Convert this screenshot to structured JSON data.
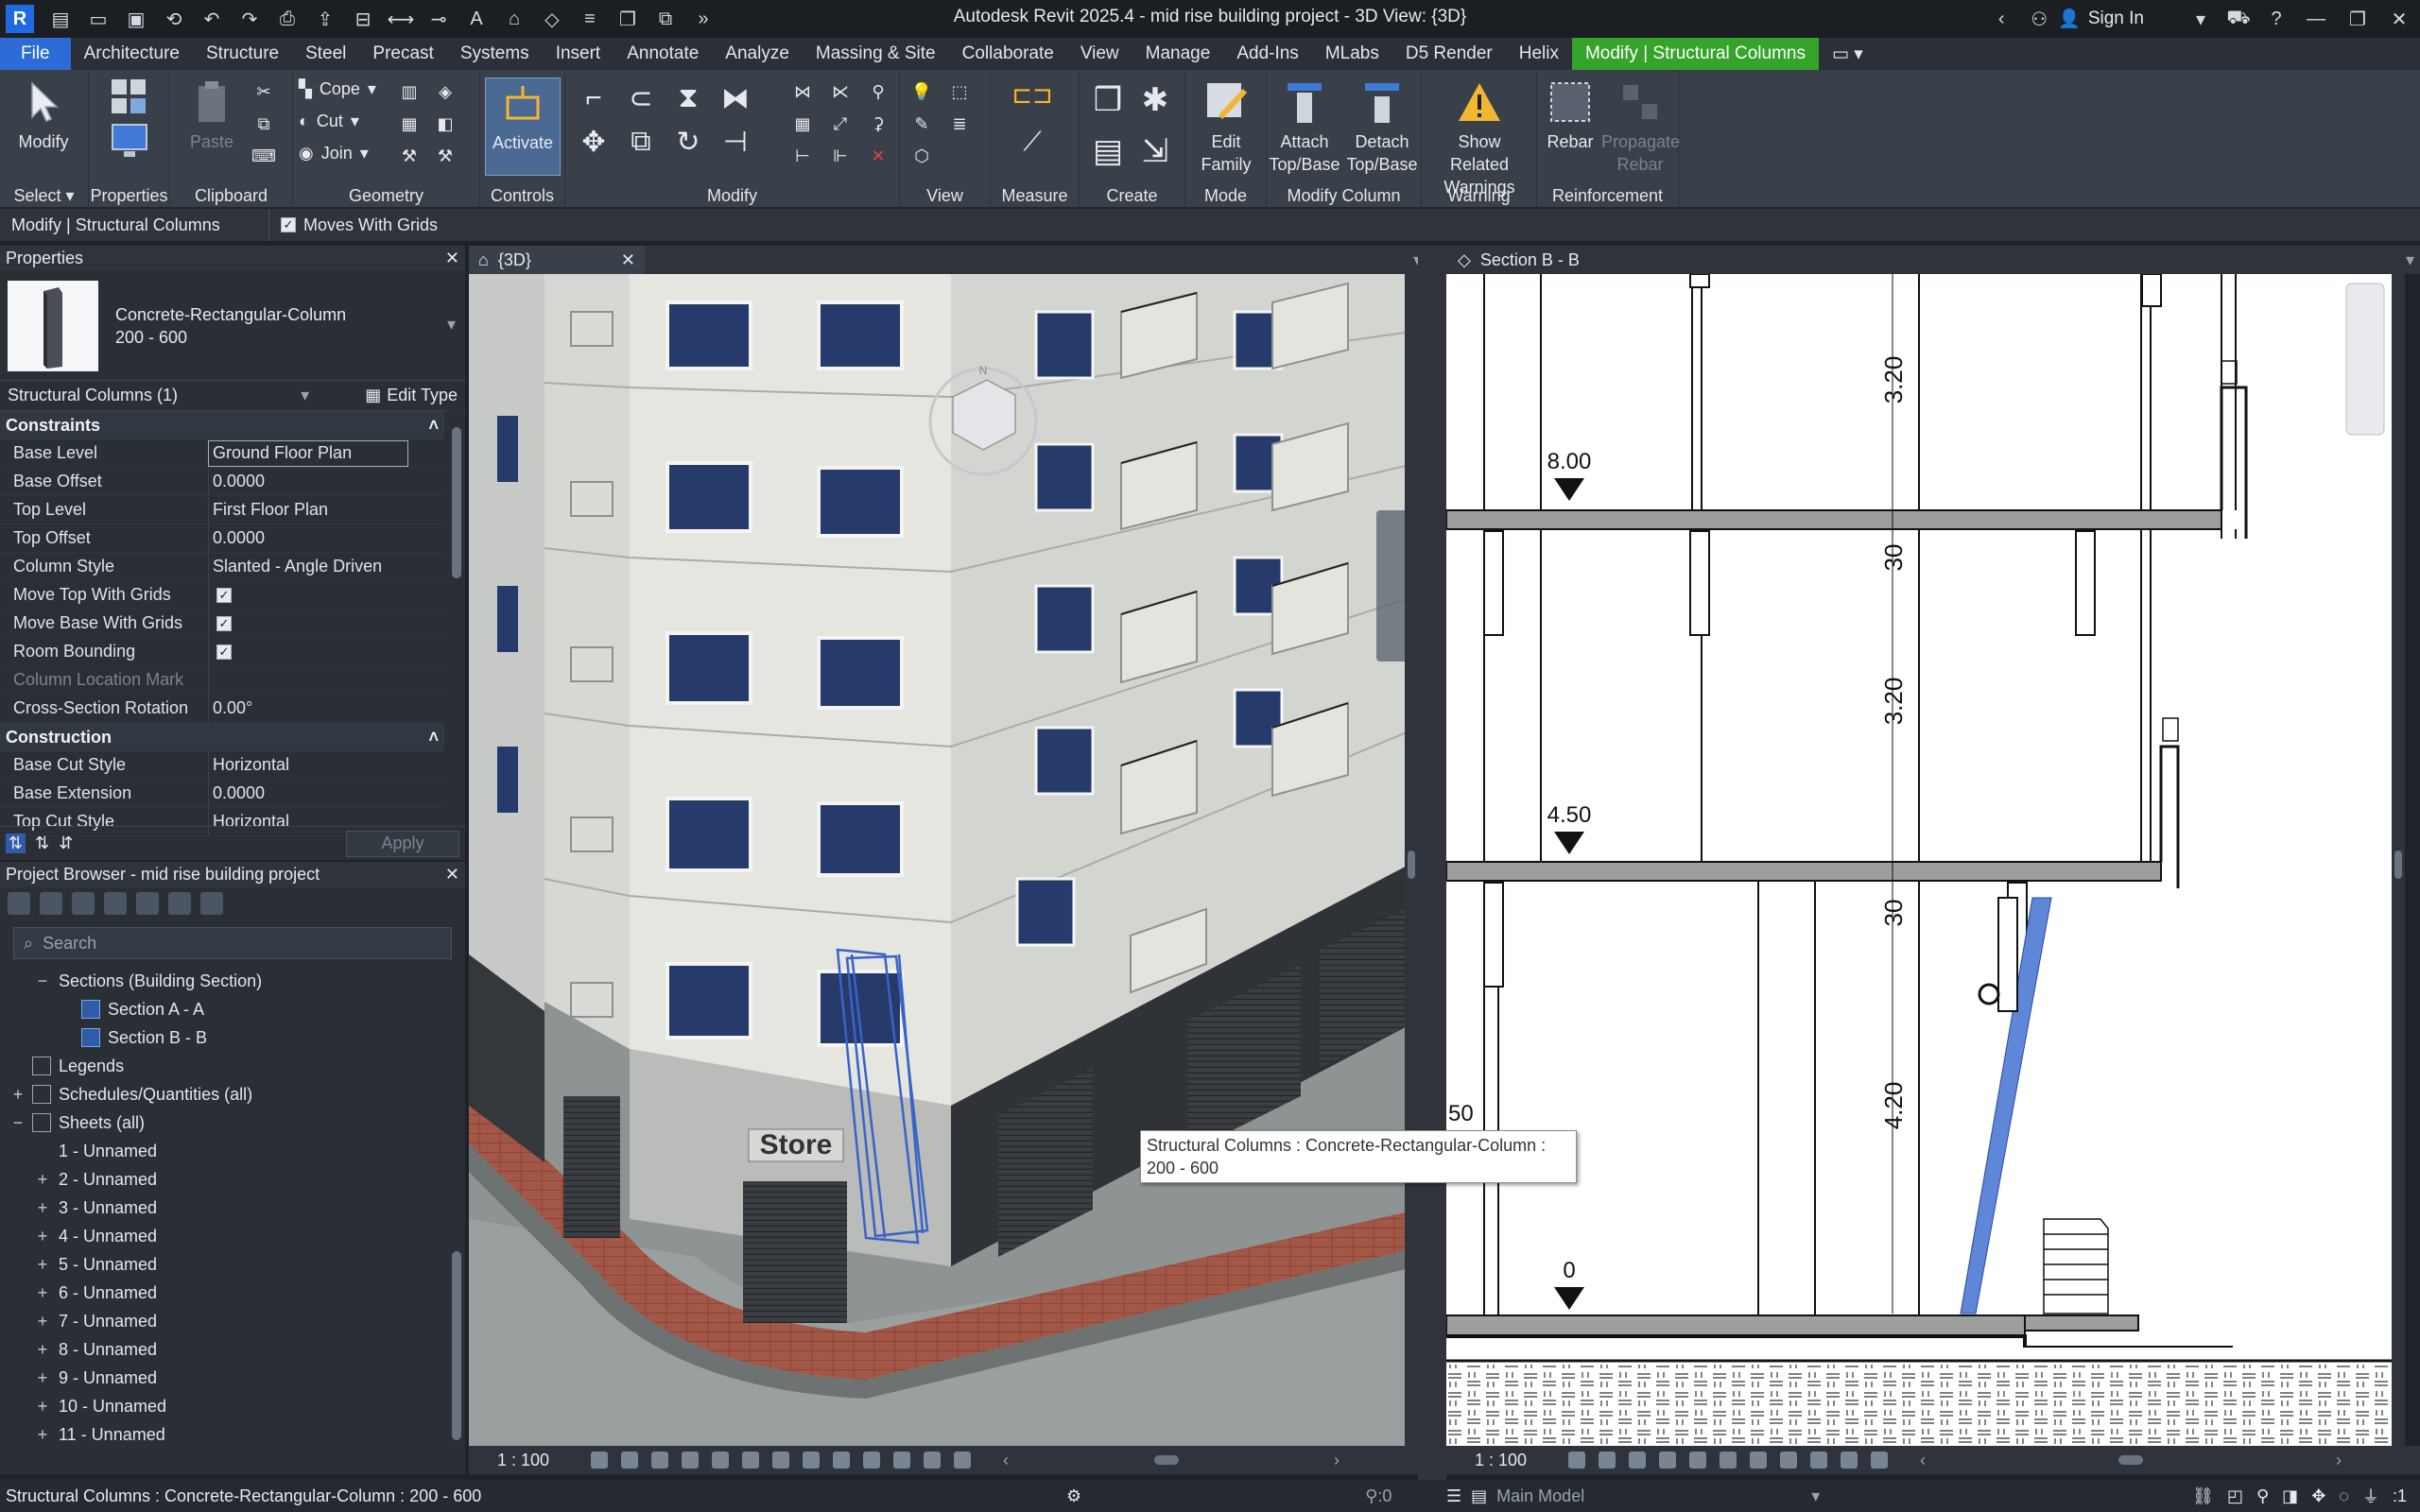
{
  "app": {
    "title": "Autodesk Revit 2025.4 - mid rise building project - 3D View: {3D}",
    "logo": "R",
    "sign_in": "Sign In"
  },
  "colors": {
    "file_tab": "#2d6bd6",
    "contextual_tab": "#35a42a",
    "accent_blue": "#2e5ca8",
    "warning": "#f2b632"
  },
  "ribbon_tabs": [
    "File",
    "Architecture",
    "Structure",
    "Steel",
    "Precast",
    "Systems",
    "Insert",
    "Annotate",
    "Analyze",
    "Massing & Site",
    "Collaborate",
    "View",
    "Manage",
    "Add-Ins",
    "MLabs",
    "D5 Render",
    "Helix",
    "Modify | Structural Columns"
  ],
  "ribbon": {
    "select": {
      "modify": "Modify",
      "label": "Select"
    },
    "properties": {
      "label": "Properties"
    },
    "clipboard": {
      "paste": "Paste",
      "label": "Clipboard"
    },
    "geometry": {
      "cope": "Cope",
      "cut": "Cut",
      "join": "Join",
      "label": "Geometry"
    },
    "controls": {
      "activate": "Activate",
      "label": "Controls"
    },
    "modify": {
      "label": "Modify"
    },
    "view": {
      "label": "View"
    },
    "measure": {
      "label": "Measure"
    },
    "create": {
      "label": "Create"
    },
    "mode": {
      "edit_family_1": "Edit",
      "edit_family_2": "Family",
      "label": "Mode"
    },
    "modify_column": {
      "attach_1": "Attach",
      "attach_2": "Top/Base",
      "detach_1": "Detach",
      "detach_2": "Top/Base",
      "label": "Modify Column"
    },
    "warning": {
      "show_1": "Show Related",
      "show_2": "Warnings",
      "label": "Warning"
    },
    "reinforcement": {
      "rebar": "Rebar",
      "propagate_1": "Propagate",
      "propagate_2": "Rebar",
      "label": "Reinforcement"
    }
  },
  "options_bar": {
    "context": "Modify | Structural Columns",
    "moves_with_grids": "Moves With Grids"
  },
  "properties": {
    "title": "Properties",
    "type_name": "Concrete-Rectangular-Column",
    "type_size": "200 - 600",
    "instance_filter": "Structural Columns (1)",
    "edit_type": "Edit Type",
    "apply": "Apply",
    "groups": [
      {
        "name": "Constraints",
        "rows": [
          {
            "k": "Base Level",
            "v": "Ground Floor Plan"
          },
          {
            "k": "Base Offset",
            "v": "0.0000"
          },
          {
            "k": "Top Level",
            "v": "First Floor Plan"
          },
          {
            "k": "Top Offset",
            "v": "0.0000"
          },
          {
            "k": "Column Style",
            "v": "Slanted - Angle Driven"
          },
          {
            "k": "Move Top With Grids",
            "v": ""
          },
          {
            "k": "Move Base With Grids",
            "v": ""
          },
          {
            "k": "Room Bounding",
            "v": ""
          },
          {
            "k": "Column Location Mark",
            "v": ""
          },
          {
            "k": "Cross-Section Rotation",
            "v": "0.00°"
          }
        ]
      },
      {
        "name": "Construction",
        "rows": [
          {
            "k": "Base Cut Style",
            "v": "Horizontal"
          },
          {
            "k": "Base Extension",
            "v": "0.0000"
          },
          {
            "k": "Top Cut Style",
            "v": "Horizontal"
          }
        ]
      }
    ]
  },
  "browser": {
    "title": "Project Browser - mid rise building project",
    "search_placeholder": "Search",
    "items": [
      {
        "label": "Sections (Building Section)",
        "exp": "−",
        "indent": 1,
        "icon": ""
      },
      {
        "label": "Section A - A",
        "exp": "",
        "indent": 2,
        "icon": "view"
      },
      {
        "label": "Section B - B",
        "exp": "",
        "indent": 2,
        "icon": "view"
      },
      {
        "label": "Legends",
        "exp": "",
        "indent": 0,
        "icon": "plain"
      },
      {
        "label": "Schedules/Quantities (all)",
        "exp": "+",
        "indent": 0,
        "icon": "plain"
      },
      {
        "label": "Sheets (all)",
        "exp": "−",
        "indent": 0,
        "icon": "plain"
      },
      {
        "label": "1 - Unnamed",
        "exp": "",
        "indent": 1,
        "icon": ""
      },
      {
        "label": "2 - Unnamed",
        "exp": "+",
        "indent": 1,
        "icon": ""
      },
      {
        "label": "3 - Unnamed",
        "exp": "+",
        "indent": 1,
        "icon": ""
      },
      {
        "label": "4 - Unnamed",
        "exp": "+",
        "indent": 1,
        "icon": ""
      },
      {
        "label": "5 - Unnamed",
        "exp": "+",
        "indent": 1,
        "icon": ""
      },
      {
        "label": "6 - Unnamed",
        "exp": "+",
        "indent": 1,
        "icon": ""
      },
      {
        "label": "7 - Unnamed",
        "exp": "+",
        "indent": 1,
        "icon": ""
      },
      {
        "label": "8 - Unnamed",
        "exp": "+",
        "indent": 1,
        "icon": ""
      },
      {
        "label": "9 - Unnamed",
        "exp": "+",
        "indent": 1,
        "icon": ""
      },
      {
        "label": "10 - Unnamed",
        "exp": "+",
        "indent": 1,
        "icon": ""
      },
      {
        "label": "11 - Unnamed",
        "exp": "+",
        "indent": 1,
        "icon": ""
      }
    ]
  },
  "views": {
    "tab_3d": "{3D}",
    "tab_section": "Section B - B",
    "scale_3d": "1 : 100",
    "scale_section": "1 : 100",
    "store_sign": "Store",
    "section_levels": [
      "8.00",
      "4.50",
      "0",
      "50"
    ],
    "section_dims": [
      "3.20",
      "30",
      "3.20",
      "30",
      "4.20"
    ]
  },
  "tooltip": "Structural Columns : Concrete-Rectangular-Column : 200 - 600",
  "status": {
    "message": "Structural Columns : Concrete-Rectangular-Column : 200 - 600",
    "workset_count": ":0",
    "model": "Main Model",
    "filter_count": ":1"
  }
}
